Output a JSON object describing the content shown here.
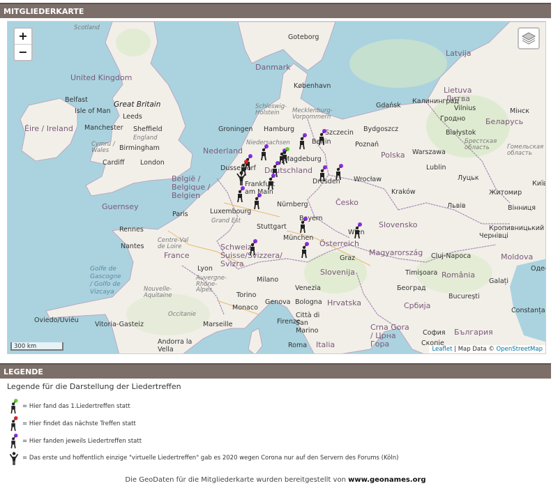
{
  "sections": {
    "map_title": "MITGLIEDERKARTE",
    "legend_title": "LEGENDE"
  },
  "map": {
    "zoom_in": "+",
    "zoom_out": "−",
    "scale": "300 km",
    "attribution": {
      "leaflet": "Leaflet",
      "sep": " | Map Data © ",
      "osm": "OpenStreetMap"
    },
    "labels": {
      "scotland": "Scotland",
      "goteborg": "Goteborg",
      "latvija": "Latvija",
      "united_kingdom": "United Kingdom",
      "danmark": "Danmark",
      "kobenhavn": "København",
      "lietuva": "Lietuva",
      "litva": "Литва",
      "belfast": "Belfast",
      "great_britain": "Great Britain",
      "isle_of_man": "Isle of Man",
      "leeds": "Leeds",
      "gdansk": "Gdańsk",
      "kaliningrad": "Калининград",
      "vilnius": "Vilnius",
      "minsk": "Мінск",
      "eire": "Éire / Ireland",
      "manchester": "Manchester",
      "sheffield": "Sheffield",
      "schleswig": "Schleswig-Holstein",
      "mecklenburg": "Mecklenburg-Vorpommern",
      "grodno": "Гродно",
      "belarus": "Беларусь",
      "england": "England",
      "groningen": "Groningen",
      "hamburg": "Hamburg",
      "szczecin": "Szczecin",
      "bydgoszcz": "Bydgoszcz",
      "bialystok": "Białystok",
      "birmingham": "Birmingham",
      "cymru": "Cymru / Wales",
      "nederland": "Nederland",
      "niedersachsen": "Niedersachsen",
      "berlin": "Berlin",
      "poznan": "Poznań",
      "brest": "Брестская область",
      "gomel": "Гомельская область",
      "cardiff": "Cardiff",
      "london": "London",
      "dusseldorf": "Dusseldorf",
      "magdeburg": "Magdeburg",
      "polska": "Polska",
      "warszawa": "Warszawa",
      "deutschland": "Deutschland",
      "lublin": "Lublin",
      "lutsk": "Луцьк",
      "belgique": "België / Belgique / Belgien",
      "dresden": "Dresden",
      "wroclaw": "Wrocław",
      "kyiv": "Київ",
      "frankfurt": "Frankfurt am Main",
      "krakow": "Kraków",
      "zhytomyr": "Житомир",
      "guernsey": "Guernsey",
      "luxembourg": "Luxembourg",
      "cesko": "Česko",
      "lviv": "Львів",
      "vinnytsia": "Вінниця",
      "paris": "Paris",
      "nurnberg": "Nürnberg",
      "rennes": "Rennes",
      "grand_est": "Grand Est",
      "stuttgart": "Stuttgart",
      "slovensko": "Slovensko",
      "bayern": "Bayern",
      "kropyvnytskyi": "Кропивницький",
      "nantes": "Nantes",
      "centre": "Centre-Val de Loire",
      "munchen": "München",
      "wien": "Wien",
      "chernivtsi": "Чернівці",
      "france": "France",
      "osterreich": "Österreich",
      "magyarorszag": "Magyarország",
      "cluj": "Cluj-Napoca",
      "moldova": "Moldova",
      "schweiz": "Schweiz/ Suisse/Svizzera/ Svizra",
      "graz": "Graz",
      "golfe": "Golfe de Gascogne / Golfo de Vizcaya",
      "lyon": "Lyon",
      "milano": "Milano",
      "slovenija": "Slovenija",
      "timisoara": "Timișoara",
      "romania": "România",
      "odesa": "Одеса",
      "auvergne": "Auvergne-Rhône-Alpes",
      "venezia": "Venezia",
      "hrvatska": "Hrvatska",
      "beograd": "Београд",
      "galati": "Galați",
      "aquitaine": "Nouvelle-Aquitaine",
      "torino": "Torino",
      "genova": "Genova",
      "bologna": "Bologna",
      "srbija": "Србија",
      "bucuresti": "București",
      "monaco": "Monaco",
      "constanta": "Constanța",
      "occitanie": "Occitanie",
      "citta": "Città di San Marino",
      "oviedo": "Oviedo/Uviéu",
      "vitoria": "Vitoria-Gasteiz",
      "marseille": "Marseille",
      "crna_gora": "Crna Gora / Црна Гора",
      "sofia": "София",
      "bulgaria": "България",
      "andorra": "Andorra la Vella",
      "roma": "Roma",
      "italia": "Italia",
      "skopje": "Скопје",
      "firenze": "Firenze"
    }
  },
  "legend": {
    "intro": "Legende für die Darstellung der Liedertreffen",
    "items": [
      {
        "color": "#5fd12b",
        "text": "= Hier fand das 1.Liedertreffen statt"
      },
      {
        "color": "#e02424",
        "text": "= Hier findet das nächste Treffen statt"
      },
      {
        "color": "#8a2be2",
        "text": "= Hier fanden jeweils Liedertreffen statt"
      },
      {
        "color": "virtual",
        "text": "= Das erste und hoffentlich einzige \"virtuelle Liedertreffen\" gab es 2020 wegen Corona nur auf den Servern des Forums (Köln)"
      }
    ]
  },
  "footer": {
    "text": "Die GeoDaten für die Mitgliederkarte wurden bereitgestellt von ",
    "link": "www.geonames.org"
  },
  "colors": {
    "header_bg": "#7c6f69",
    "sea": "#aad3df",
    "land": "#f2efe9",
    "first_meeting": "#5fd12b",
    "next_meeting": "#e02424",
    "meetings": "#8a2be2"
  },
  "icons": {
    "marker": "singer-person-icon",
    "layers": "layers-icon"
  }
}
